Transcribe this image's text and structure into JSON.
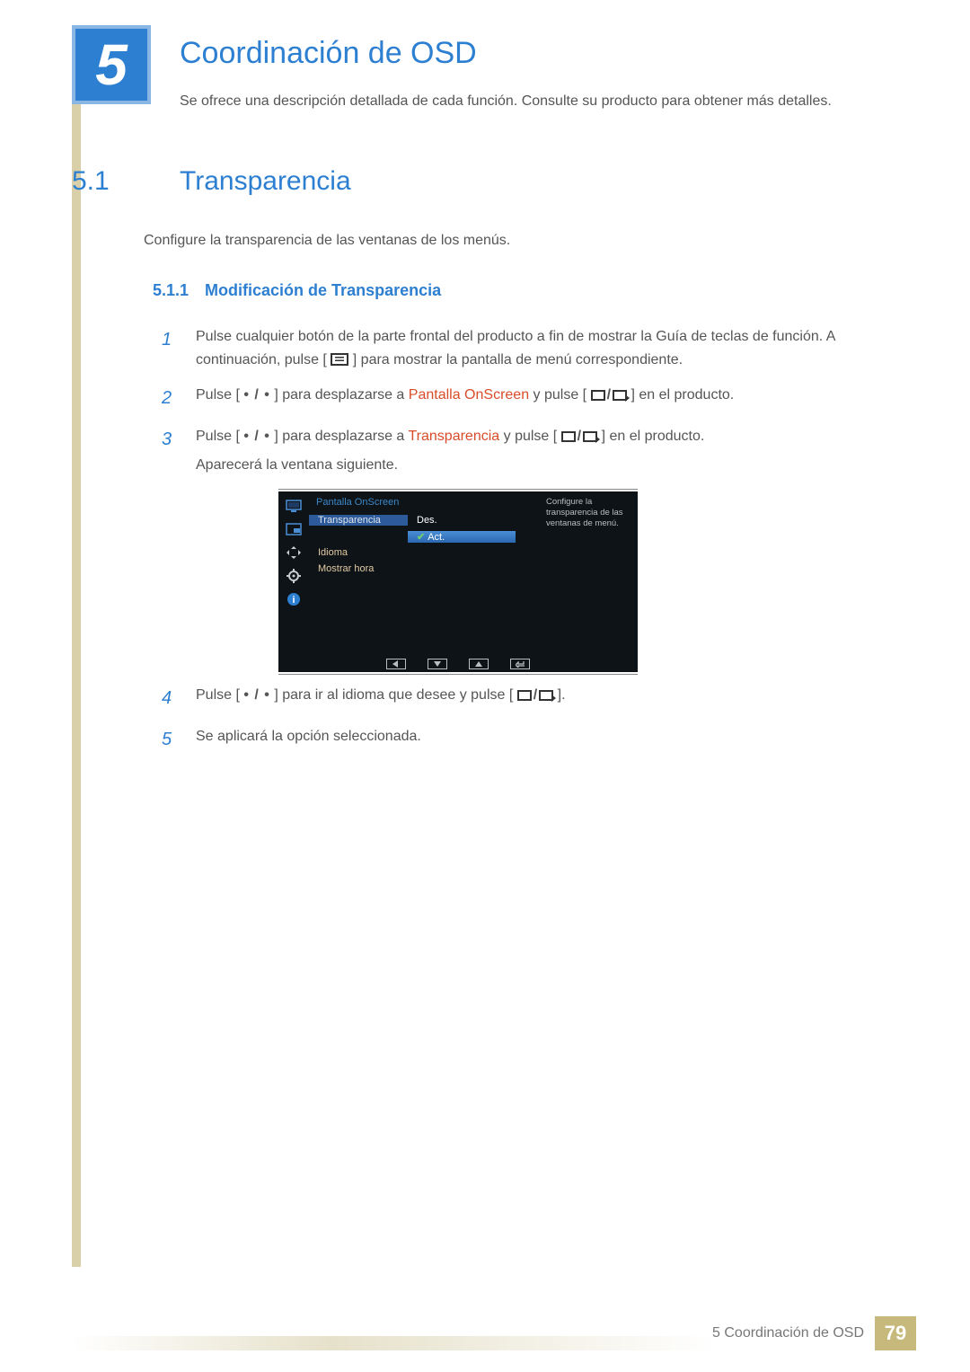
{
  "chapter": {
    "number": "5",
    "title": "Coordinación de OSD",
    "description": "Se ofrece una descripción detallada de cada función. Consulte su producto para obtener más detalles."
  },
  "section": {
    "number": "5.1",
    "title": "Transparencia",
    "description": "Configure la transparencia de las ventanas de los menús."
  },
  "subsection": {
    "number": "5.1.1",
    "title": "Modificación de Transparencia"
  },
  "steps": {
    "s1_num": "1",
    "s1a": "Pulse cualquier botón de la parte frontal del producto a fin de mostrar la Guía de teclas de función. A continuación, pulse [",
    "s1b": "] para mostrar la pantalla de menú correspondiente.",
    "s2_num": "2",
    "s2a": "Pulse [ ",
    "s2_dots": "• / •",
    "s2b": " ] para desplazarse a ",
    "s2_hl": "Pantalla OnScreen",
    "s2c": " y pulse [",
    "s2d": "] en el producto.",
    "s3_num": "3",
    "s3a": "Pulse [ ",
    "s3_dots": "• / •",
    "s3b": " ] para desplazarse a ",
    "s3_hl": "Transparencia",
    "s3c": " y pulse [",
    "s3d": "] en el producto.",
    "s3_after": "Aparecerá la ventana siguiente.",
    "s4_num": "4",
    "s4a": "Pulse [ ",
    "s4_dots": "• / •",
    "s4b": " ] para ir al idioma que desee y pulse [",
    "s4c": "].",
    "s5_num": "5",
    "s5_text": "Se aplicará la opción seleccionada."
  },
  "osd": {
    "header": "Pantalla OnScreen",
    "items": {
      "transparencia": "Transparencia",
      "idioma": "Idioma",
      "mostrar_hora": "Mostrar hora"
    },
    "options": {
      "des": "Des.",
      "act": "Act."
    },
    "help": "Configure la transparencia de las ventanas de menú."
  },
  "footer": {
    "text": "5 Coordinación de OSD",
    "page": "79"
  }
}
